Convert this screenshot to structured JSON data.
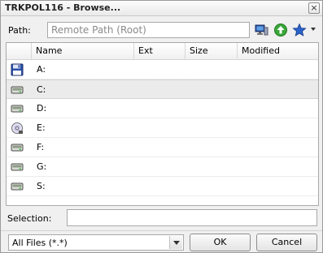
{
  "window": {
    "title": "TRKPOL116 - Browse...",
    "close_glyph": "×"
  },
  "path": {
    "label": "Path:",
    "value": "Remote Path (Root)"
  },
  "toolbar": {
    "icons": [
      "computer-icon",
      "up-arrow-icon",
      "favorites-star-icon"
    ]
  },
  "columns": [
    "Name",
    "Ext",
    "Size",
    "Modified"
  ],
  "rows": [
    {
      "name": "A:",
      "icon": "floppy-drive-icon",
      "selected": false
    },
    {
      "name": "C:",
      "icon": "hard-drive-icon",
      "selected": true
    },
    {
      "name": "D:",
      "icon": "hard-drive-icon",
      "selected": false
    },
    {
      "name": "E:",
      "icon": "cd-drive-icon",
      "selected": false
    },
    {
      "name": "F:",
      "icon": "hard-drive-icon",
      "selected": false
    },
    {
      "name": "G:",
      "icon": "hard-drive-icon",
      "selected": false
    },
    {
      "name": "S:",
      "icon": "hard-drive-icon",
      "selected": false
    }
  ],
  "selection": {
    "label": "Selection:",
    "value": ""
  },
  "filter": {
    "value": "All Files (*.*)"
  },
  "buttons": {
    "ok": "OK",
    "cancel": "Cancel"
  },
  "colors": {
    "selected_row": "#ebebeb",
    "accent_green": "#3aa63a",
    "accent_blue": "#2a62c9"
  }
}
